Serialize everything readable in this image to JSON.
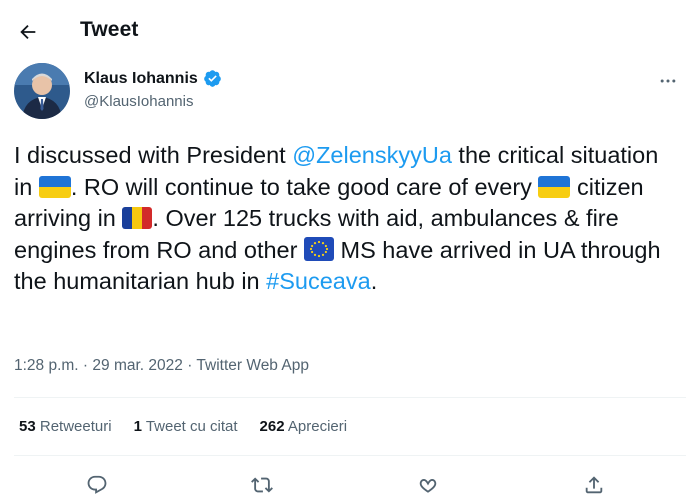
{
  "header": {
    "title": "Tweet"
  },
  "author": {
    "name": "Klaus Iohannis",
    "handle": "@KlausIohannis",
    "verified": true
  },
  "tweet": {
    "part1": "I discussed with President ",
    "mention": "@ZelenskyyUa",
    "part2": " the critical situation in ",
    "part3": ". RO will continue to take good care of every ",
    "part4": " citizen arriving in ",
    "part5": ". Over 125 trucks with aid, ambulances & fire engines from RO and other ",
    "part6": " MS have arrived in UA through the humanitarian hub in ",
    "hashtag": "#Suceava",
    "part7": "."
  },
  "meta": {
    "time": "1:28 p.m.",
    "sep1": " · ",
    "date": "29 mar. 2022",
    "sep2": " · ",
    "source": "Twitter Web App"
  },
  "stats": {
    "retweets_count": "53",
    "retweets_label": "Retweeturi",
    "quotes_count": "1",
    "quotes_label": "Tweet cu citat",
    "likes_count": "262",
    "likes_label": "Aprecieri"
  },
  "colors": {
    "link": "#1d9bf0",
    "secondary_text": "#536471",
    "verified": "#1d9bf0"
  }
}
